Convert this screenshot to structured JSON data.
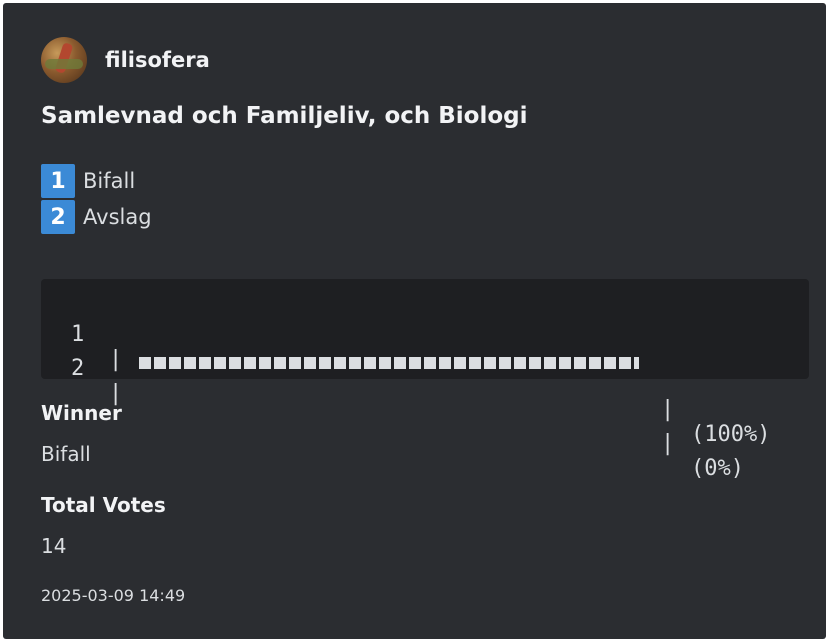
{
  "author": {
    "name": "filisofera"
  },
  "poll": {
    "title": "Samlevnad och Familjeliv, och Biologi",
    "options": [
      {
        "number": "1",
        "label": "Bifall"
      },
      {
        "number": "2",
        "label": "Avslag"
      }
    ],
    "results": [
      {
        "index": "1",
        "sep": "|",
        "end": "|",
        "percent_label": "(100%)",
        "fraction": 1.0
      },
      {
        "index": "2",
        "sep": "|",
        "end": "|",
        "percent_label": "(0%)",
        "fraction": 0.0
      }
    ]
  },
  "fields": {
    "winner": {
      "name": "Winner",
      "value": "Bifall"
    },
    "total_votes": {
      "name": "Total Votes",
      "value": "14"
    }
  },
  "footer": {
    "timestamp": "2025-03-09 14:49"
  },
  "colors": {
    "background": "#2b2d31",
    "code_background": "#1e1f22",
    "number_badge": "#3b8ad6",
    "text": "#dbdee1"
  }
}
